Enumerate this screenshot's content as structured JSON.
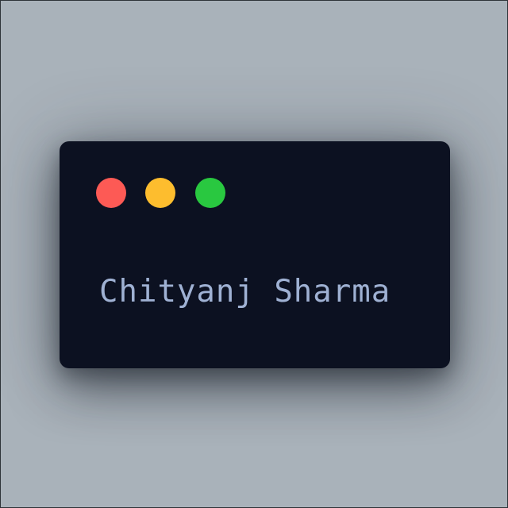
{
  "colors": {
    "background": "#a9b2ba",
    "window_background": "#0c1121",
    "close_button": "#fd5a55",
    "minimize_button": "#fdbd2e",
    "maximize_button": "#29c840",
    "text": "#9fb1d3"
  },
  "window": {
    "buttons": [
      {
        "name": "close",
        "color": "#fd5a55"
      },
      {
        "name": "minimize",
        "color": "#fdbd2e"
      },
      {
        "name": "maximize",
        "color": "#29c840"
      }
    ],
    "text": "Chityanj Sharma"
  }
}
